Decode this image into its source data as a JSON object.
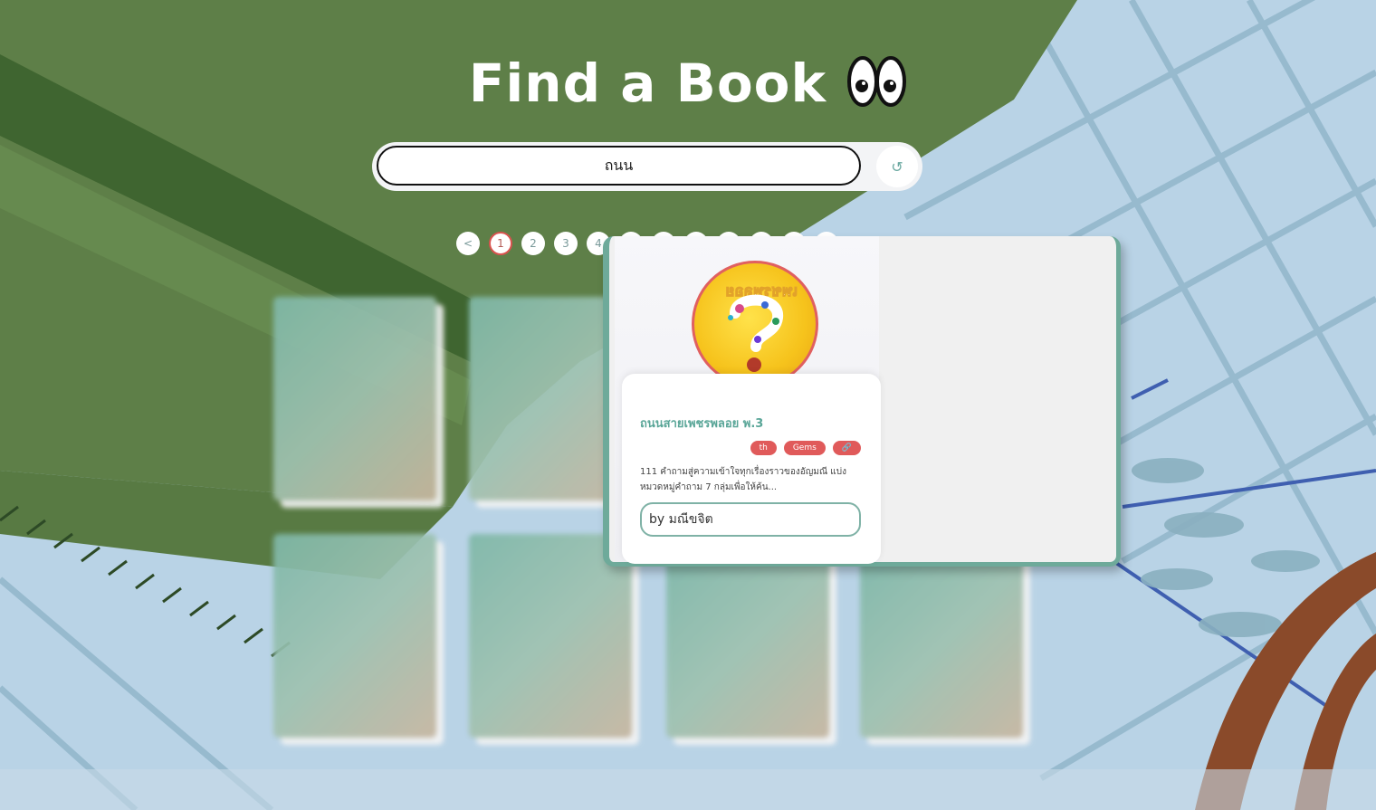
{
  "header": {
    "title": "Find a Book"
  },
  "search": {
    "value": "ถนน",
    "reset_icon": "↺"
  },
  "pagination": {
    "prev_label": "<",
    "pages": [
      "1",
      "2",
      "3",
      "4"
    ],
    "active_page": "1"
  },
  "book_modal": {
    "title": "ถนนสายเพชรพลอย พ.3",
    "tags": [
      "th",
      "Gems",
      "🔗"
    ],
    "description": "111 คำถามสู่ความเข้าใจทุกเรื่องราวของอัญมณี แบ่งหมวดหมู่คำถาม 7 กลุ่มเพื่อให้ค้น...",
    "author": "by มณีขจิต"
  },
  "colors": {
    "accent_green": "#6eaa9a",
    "tag_red": "#e05a5a",
    "background_green": "#5a7f45",
    "background_blue": "#b9d3e6"
  }
}
